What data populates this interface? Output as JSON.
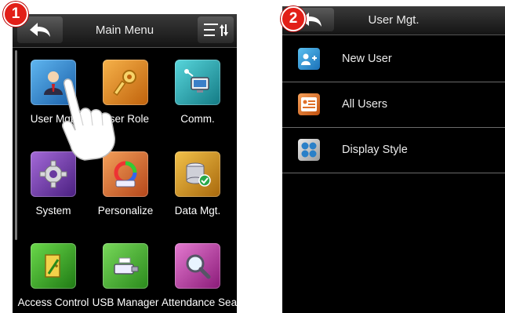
{
  "steps": {
    "first": "1",
    "second": "2"
  },
  "main_menu": {
    "title": "Main Menu",
    "items": [
      {
        "label": "User Mgt.",
        "icon": "user-mgt-icon",
        "color": "#2f8fd8"
      },
      {
        "label": "User Role",
        "icon": "key-icon",
        "color": "#e88a1e"
      },
      {
        "label": "Comm.",
        "icon": "network-icon",
        "color": "#22b0b8"
      },
      {
        "label": "System",
        "icon": "gear-icon",
        "color": "#7a3fb0"
      },
      {
        "label": "Personalize",
        "icon": "palette-icon",
        "color": "#e07a2a"
      },
      {
        "label": "Data Mgt.",
        "icon": "database-icon",
        "color": "#d89a1a"
      },
      {
        "label": "Access Control",
        "icon": "door-icon",
        "color": "#3aa02a"
      },
      {
        "label": "USB Manager",
        "icon": "usb-icon",
        "color": "#4caa36"
      },
      {
        "label": "Attendance Search",
        "icon": "search-icon",
        "color": "#c03aa0"
      }
    ]
  },
  "user_mgt": {
    "title": "User Mgt.",
    "items": [
      {
        "label": "New User",
        "icon": "add-user-icon",
        "color": "#2f9ad8"
      },
      {
        "label": "All Users",
        "icon": "user-list-icon",
        "color": "#e8742a"
      },
      {
        "label": "Display Style",
        "icon": "display-style-icon",
        "color": "#3aa0d0"
      }
    ]
  }
}
